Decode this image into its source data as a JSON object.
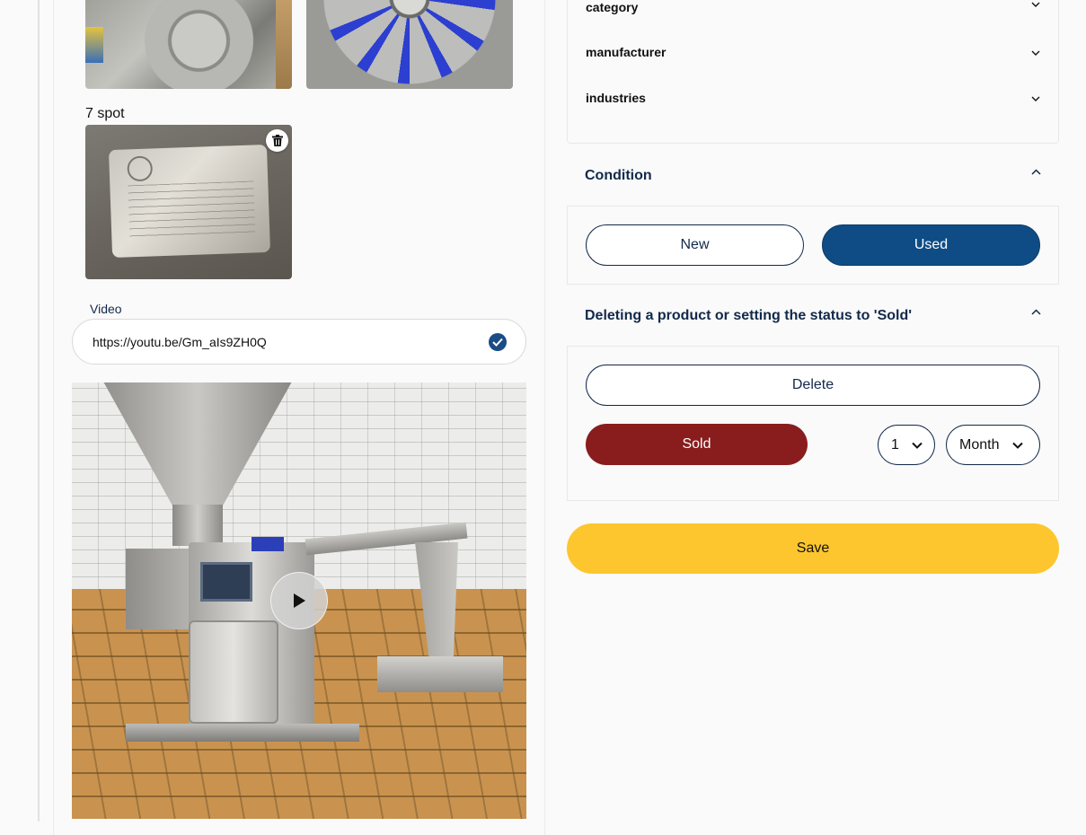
{
  "gallery": {
    "spot_label": "7 spot"
  },
  "video": {
    "label": "Video",
    "url": "https://youtu.be/Gm_aIs9ZH0Q"
  },
  "filters": {
    "category": "category",
    "manufacturer": "manufacturer",
    "industries": "industries"
  },
  "condition": {
    "title": "Condition",
    "new_label": "New",
    "used_label": "Used",
    "selected": "Used"
  },
  "status": {
    "title": "Deleting a product or setting the status to 'Sold'",
    "delete_label": "Delete",
    "sold_label": "Sold",
    "duration_value": "1",
    "duration_unit": "Month"
  },
  "actions": {
    "save_label": "Save"
  },
  "colors": {
    "primary": "#0f4c85",
    "danger": "#891d1d",
    "save": "#fdc62e",
    "heading": "#12294a"
  }
}
